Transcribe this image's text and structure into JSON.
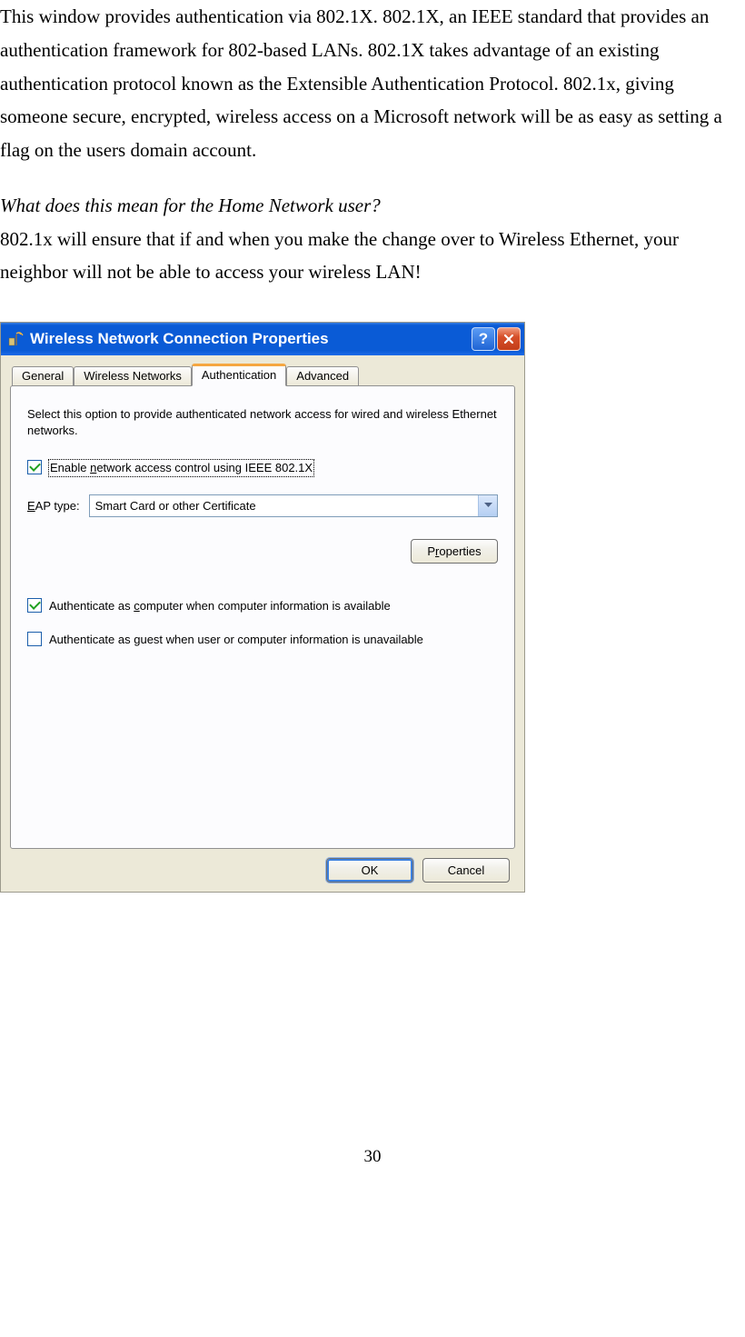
{
  "doc": {
    "para1": "This window provides authentication via 802.1X. 802.1X, an IEEE standard that provides an authentication framework for 802-based LANs. 802.1X takes advantage of an existing authentication protocol known as the Extensible Authentication Protocol. 802.1x, giving someone secure, encrypted, wireless access on a Microsoft network will be as easy as setting a flag on the users domain account.",
    "heading": "What does this mean for the Home Network user?",
    "para2": "802.1x will ensure that if and when you make the change over to Wireless Ethernet, your neighbor will not be able to access your wireless LAN!",
    "page_number": "30"
  },
  "dialog": {
    "title": "Wireless Network Connection Properties",
    "tabs": [
      "General",
      "Wireless Networks",
      "Authentication",
      "Advanced"
    ],
    "active_tab_index": 2,
    "description": "Select this option to provide authenticated network access for wired and wireless Ethernet networks.",
    "checkbox_enable_label": "Enable network access control using IEEE 802.1X",
    "checkbox_enable_checked": true,
    "eap_label": "EAP type:",
    "eap_value": "Smart Card or other Certificate",
    "properties_button": "Properties",
    "checkbox_computer_label": "Authenticate as computer when computer information is available",
    "checkbox_computer_checked": true,
    "checkbox_guest_label": "Authenticate as guest when user or computer information is unavailable",
    "checkbox_guest_checked": false,
    "ok_button": "OK",
    "cancel_button": "Cancel"
  }
}
